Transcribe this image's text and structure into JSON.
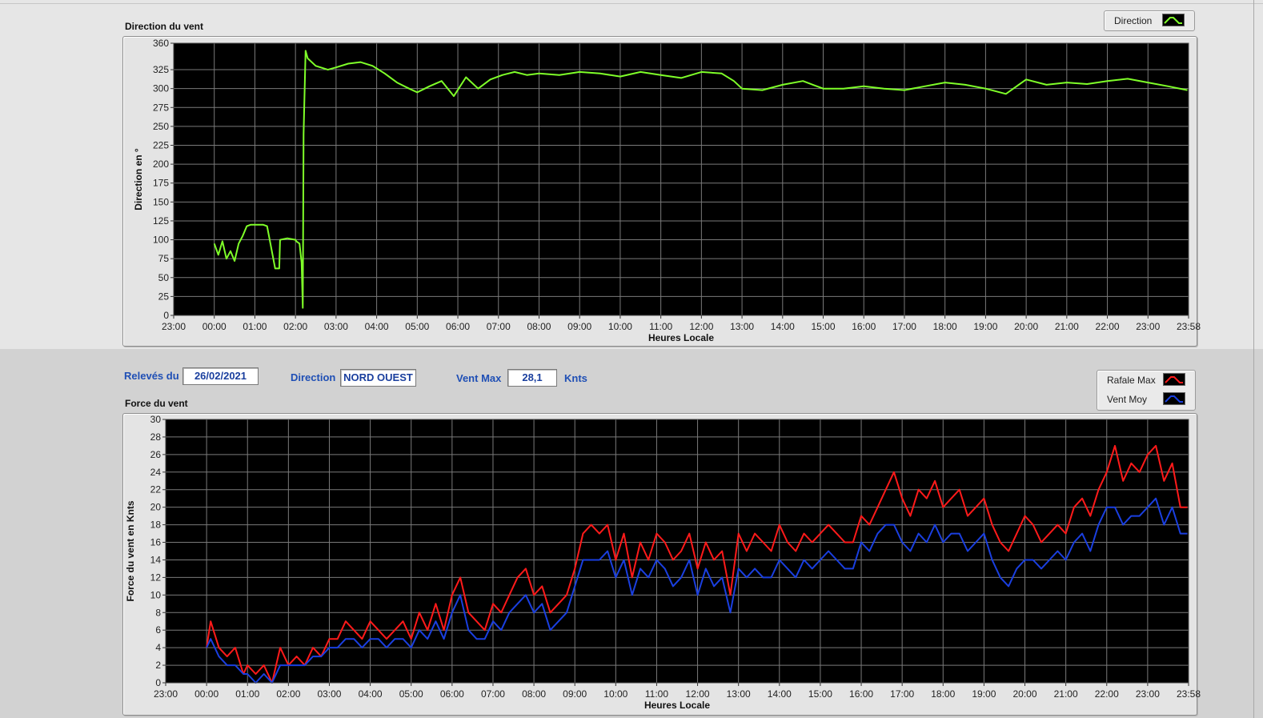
{
  "direction_panel": {
    "title": "Direction du vent",
    "legend": [
      {
        "label": "Direction",
        "color": "#7fff29"
      }
    ]
  },
  "controls": {
    "date_label": "Relevés du",
    "date_value": "26/02/2021",
    "direction_label": "Direction",
    "direction_value": "NORD OUEST",
    "vmax_label": "Vent Max",
    "vmax_value": "28,1",
    "vmax_unit": "Knts"
  },
  "force_panel": {
    "title": "Force du vent",
    "legend": [
      {
        "label": "Rafale Max",
        "color": "#ff1a1a"
      },
      {
        "label": "Vent Moy",
        "color": "#1a3fe0"
      }
    ]
  },
  "chart_data": [
    {
      "type": "line",
      "xlabel": "Heures Locale",
      "ylabel": "Direction en °",
      "x_tick_labels": [
        "23:00",
        "00:00",
        "01:00",
        "02:00",
        "03:00",
        "04:00",
        "05:00",
        "06:00",
        "07:00",
        "08:00",
        "09:00",
        "10:00",
        "11:00",
        "12:00",
        "13:00",
        "14:00",
        "15:00",
        "16:00",
        "17:00",
        "18:00",
        "19:00",
        "20:00",
        "21:00",
        "22:00",
        "23:00",
        "23:58"
      ],
      "y_ticks": [
        0,
        25,
        50,
        75,
        100,
        125,
        150,
        175,
        200,
        225,
        250,
        275,
        300,
        325,
        360
      ],
      "ylim": [
        0,
        360
      ],
      "grid": true,
      "background": "#000000",
      "series": [
        {
          "name": "Direction",
          "color": "#7fff29",
          "x": [
            1.0,
            1.1,
            1.2,
            1.3,
            1.4,
            1.5,
            1.6,
            1.7,
            1.8,
            1.9,
            2.0,
            2.1,
            2.2,
            2.3,
            2.5,
            2.6,
            2.62,
            2.8,
            3.0,
            3.02,
            3.1,
            3.15,
            3.18,
            3.2,
            3.25,
            3.3,
            3.5,
            3.8,
            4.0,
            4.3,
            4.6,
            4.9,
            5.2,
            5.5,
            5.8,
            6.0,
            6.3,
            6.6,
            6.9,
            7.2,
            7.5,
            7.8,
            8.1,
            8.4,
            8.7,
            9.0,
            9.5,
            10.0,
            10.5,
            11.0,
            11.5,
            12.0,
            12.5,
            13.0,
            13.5,
            13.8,
            14.0,
            14.5,
            15.0,
            15.5,
            16.0,
            16.5,
            17.0,
            17.5,
            18.0,
            18.5,
            19.0,
            19.5,
            20.0,
            20.5,
            21.0,
            21.5,
            22.0,
            22.5,
            23.0,
            23.5,
            24.0,
            24.5,
            24.97
          ],
          "y": [
            95,
            80,
            98,
            75,
            85,
            72,
            95,
            105,
            118,
            120,
            120,
            120,
            120,
            118,
            62,
            62,
            100,
            102,
            100,
            98,
            95,
            70,
            10,
            240,
            350,
            340,
            330,
            325,
            328,
            333,
            335,
            330,
            320,
            308,
            300,
            295,
            303,
            310,
            290,
            315,
            300,
            312,
            318,
            322,
            318,
            320,
            318,
            322,
            320,
            316,
            322,
            318,
            314,
            322,
            320,
            310,
            300,
            298,
            305,
            310,
            300,
            300,
            303,
            300,
            298,
            303,
            308,
            305,
            300,
            293,
            312,
            305,
            308,
            306,
            310,
            313,
            308,
            303,
            298
          ]
        }
      ]
    },
    {
      "type": "line",
      "xlabel": "Heures Locale",
      "ylabel": "Force du vent en Knts",
      "x_tick_labels": [
        "23:00",
        "00:00",
        "01:00",
        "02:00",
        "03:00",
        "04:00",
        "05:00",
        "06:00",
        "07:00",
        "08:00",
        "09:00",
        "10:00",
        "11:00",
        "12:00",
        "13:00",
        "14:00",
        "15:00",
        "16:00",
        "17:00",
        "18:00",
        "19:00",
        "20:00",
        "21:00",
        "22:00",
        "23:00",
        "23:58"
      ],
      "y_ticks": [
        0,
        2,
        4,
        6,
        8,
        10,
        12,
        14,
        16,
        18,
        20,
        22,
        24,
        26,
        28,
        30
      ],
      "ylim": [
        0,
        30
      ],
      "grid": true,
      "background": "#000000",
      "series": [
        {
          "name": "Rafale Max",
          "color": "#ff1a1a",
          "x": [
            1.0,
            1.1,
            1.3,
            1.5,
            1.7,
            1.9,
            2.0,
            2.2,
            2.4,
            2.6,
            2.8,
            3.0,
            3.2,
            3.4,
            3.6,
            3.8,
            4.0,
            4.2,
            4.4,
            4.6,
            4.8,
            5.0,
            5.2,
            5.4,
            5.6,
            5.8,
            6.0,
            6.2,
            6.4,
            6.6,
            6.8,
            7.0,
            7.2,
            7.4,
            7.6,
            7.8,
            8.0,
            8.2,
            8.4,
            8.6,
            8.8,
            9.0,
            9.2,
            9.4,
            9.6,
            9.8,
            10.0,
            10.2,
            10.4,
            10.6,
            10.8,
            11.0,
            11.2,
            11.4,
            11.6,
            11.8,
            12.0,
            12.2,
            12.4,
            12.6,
            12.8,
            13.0,
            13.2,
            13.4,
            13.6,
            13.8,
            14.0,
            14.2,
            14.4,
            14.6,
            14.8,
            15.0,
            15.2,
            15.4,
            15.6,
            15.8,
            16.0,
            16.2,
            16.4,
            16.6,
            16.8,
            17.0,
            17.2,
            17.4,
            17.6,
            17.8,
            18.0,
            18.2,
            18.4,
            18.6,
            18.8,
            19.0,
            19.2,
            19.4,
            19.6,
            19.8,
            20.0,
            20.2,
            20.4,
            20.6,
            20.8,
            21.0,
            21.2,
            21.4,
            21.6,
            21.8,
            22.0,
            22.2,
            22.4,
            22.6,
            22.8,
            23.0,
            23.2,
            23.4,
            23.6,
            23.8,
            24.0,
            24.2,
            24.4,
            24.6,
            24.8,
            24.97
          ],
          "y": [
            4,
            7,
            4,
            3,
            4,
            1,
            2,
            1,
            2,
            0,
            4,
            2,
            3,
            2,
            4,
            3,
            5,
            5,
            7,
            6,
            5,
            7,
            6,
            5,
            6,
            7,
            5,
            8,
            6,
            9,
            6,
            10,
            12,
            8,
            7,
            6,
            9,
            8,
            10,
            12,
            13,
            10,
            11,
            8,
            9,
            10,
            13,
            17,
            18,
            17,
            18,
            14,
            17,
            12,
            16,
            14,
            17,
            16,
            14,
            15,
            17,
            13,
            16,
            14,
            15,
            10,
            17,
            15,
            17,
            16,
            15,
            18,
            16,
            15,
            17,
            16,
            17,
            18,
            17,
            16,
            16,
            19,
            18,
            20,
            22,
            24,
            21,
            19,
            22,
            21,
            23,
            20,
            21,
            22,
            19,
            20,
            21,
            18,
            16,
            15,
            17,
            19,
            18,
            16,
            17,
            18,
            17,
            20,
            21,
            19,
            22,
            24,
            27,
            23,
            25,
            24,
            26,
            27,
            23,
            25,
            20,
            20
          ],
          "peak_max": 28.1
        },
        {
          "name": "Vent Moy",
          "color": "#1a3fe0",
          "x": [
            1.0,
            1.1,
            1.3,
            1.5,
            1.7,
            1.9,
            2.0,
            2.2,
            2.4,
            2.6,
            2.8,
            3.0,
            3.2,
            3.4,
            3.6,
            3.8,
            4.0,
            4.2,
            4.4,
            4.6,
            4.8,
            5.0,
            5.2,
            5.4,
            5.6,
            5.8,
            6.0,
            6.2,
            6.4,
            6.6,
            6.8,
            7.0,
            7.2,
            7.4,
            7.6,
            7.8,
            8.0,
            8.2,
            8.4,
            8.6,
            8.8,
            9.0,
            9.2,
            9.4,
            9.6,
            9.8,
            10.0,
            10.2,
            10.4,
            10.6,
            10.8,
            11.0,
            11.2,
            11.4,
            11.6,
            11.8,
            12.0,
            12.2,
            12.4,
            12.6,
            12.8,
            13.0,
            13.2,
            13.4,
            13.6,
            13.8,
            14.0,
            14.2,
            14.4,
            14.6,
            14.8,
            15.0,
            15.2,
            15.4,
            15.6,
            15.8,
            16.0,
            16.2,
            16.4,
            16.6,
            16.8,
            17.0,
            17.2,
            17.4,
            17.6,
            17.8,
            18.0,
            18.2,
            18.4,
            18.6,
            18.8,
            19.0,
            19.2,
            19.4,
            19.6,
            19.8,
            20.0,
            20.2,
            20.4,
            20.6,
            20.8,
            21.0,
            21.2,
            21.4,
            21.6,
            21.8,
            22.0,
            22.2,
            22.4,
            22.6,
            22.8,
            23.0,
            23.2,
            23.4,
            23.6,
            23.8,
            24.0,
            24.2,
            24.4,
            24.6,
            24.8,
            24.97
          ],
          "y": [
            4,
            5,
            3,
            2,
            2,
            1,
            1,
            0,
            1,
            0,
            2,
            2,
            2,
            2,
            3,
            3,
            4,
            4,
            5,
            5,
            4,
            5,
            5,
            4,
            5,
            5,
            4,
            6,
            5,
            7,
            5,
            8,
            10,
            6,
            5,
            5,
            7,
            6,
            8,
            9,
            10,
            8,
            9,
            6,
            7,
            8,
            11,
            14,
            14,
            14,
            15,
            12,
            14,
            10,
            13,
            12,
            14,
            13,
            11,
            12,
            14,
            10,
            13,
            11,
            12,
            8,
            13,
            12,
            13,
            12,
            12,
            14,
            13,
            12,
            14,
            13,
            14,
            15,
            14,
            13,
            13,
            16,
            15,
            17,
            18,
            18,
            16,
            15,
            17,
            16,
            18,
            16,
            17,
            17,
            15,
            16,
            17,
            14,
            12,
            11,
            13,
            14,
            14,
            13,
            14,
            15,
            14,
            16,
            17,
            15,
            18,
            20,
            20,
            18,
            19,
            19,
            20,
            21,
            18,
            20,
            17,
            17
          ]
        }
      ]
    }
  ]
}
